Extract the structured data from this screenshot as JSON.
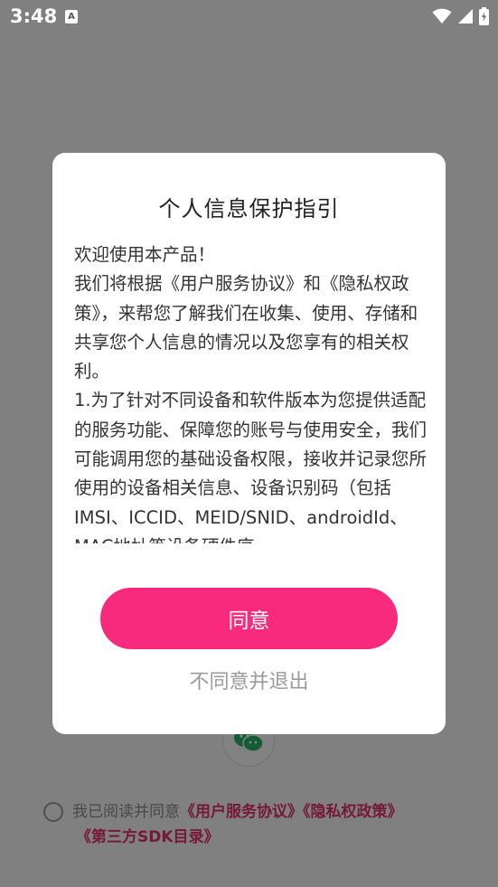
{
  "status_bar": {
    "time": "3:48",
    "notification_icon": "A"
  },
  "background": {
    "agreement": {
      "prefix": "我已阅读并同意",
      "user_agreement_link": "《用户服务协议》",
      "privacy_link": "《隐私权政策》",
      "sdk_link": "《第三方SDK目录》"
    }
  },
  "dialog": {
    "title": "个人信息保护指引",
    "paragraphs": [
      "欢迎使用本产品！",
      "我们将根据《用户服务协议》和《隐私权政策》，来帮您了解我们在收集、使用、存储和共享您个人信息的情况以及您享有的相关权利。",
      "1.为了针对不同设备和软件版本为您提供适配的服务功能、保障您的账号与使用安全，我们可能调用您的基础设备权限，接收并记录您所使用的设备相关信息、设备识别码（包括IMSI、ICCID、MEID/SNID、androidId、MAC地址等设备硬件序"
    ],
    "agree_label": "同意",
    "disagree_label": "不同意并退出"
  },
  "colors": {
    "accent": "#f72a7e",
    "link": "#e0306e",
    "scrim": "rgba(0,0,0,0.48)"
  }
}
